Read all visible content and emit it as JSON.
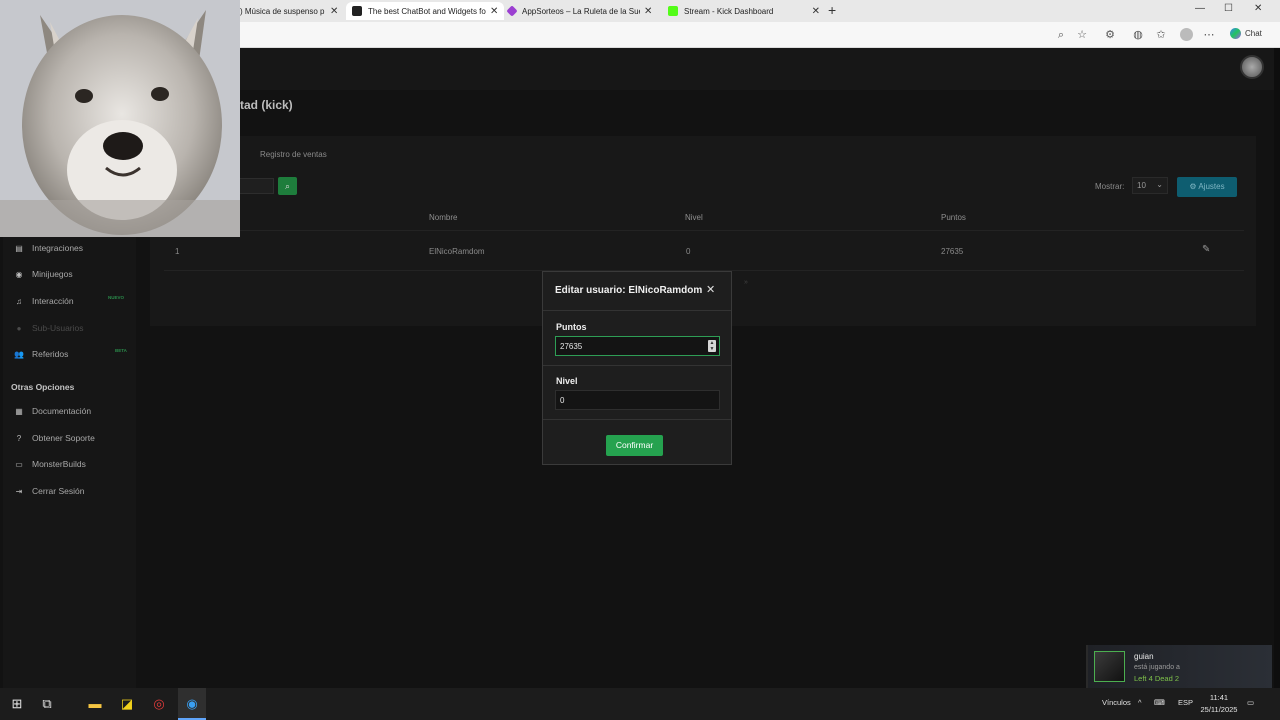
{
  "browser": {
    "tabs": [
      {
        "title": ") Música de suspenso p",
        "icon": "youtube-icon"
      },
      {
        "title": "The best ChatBot and Widgets fo",
        "icon": "chatbot-icon",
        "active": true
      },
      {
        "title": "AppSorteos – La Ruleta de la Sue",
        "icon": "appsorteos-icon"
      },
      {
        "title": "Stream - Kick Dashboard",
        "icon": "kick-icon"
      }
    ],
    "chat_label": "Chat"
  },
  "page": {
    "title": "tad (kick)",
    "subtab": "Registro de ventas",
    "mostrar_label": "Mostrar:",
    "mostrar_value": "10",
    "ajustes_label": "Ajustes",
    "columns": [
      "Nombre",
      "Nivel",
      "Puntos"
    ],
    "rows": [
      {
        "index": "1",
        "nombre": "ElNicoRamdom",
        "nivel": "0",
        "puntos": "27635"
      }
    ]
  },
  "sidebar": {
    "items": [
      {
        "label": "Integraciones",
        "icon": "integrations-icon"
      },
      {
        "label": "Minijuegos",
        "icon": "gamepad-icon"
      },
      {
        "label": "Interacción",
        "icon": "music-icon",
        "badge": "NUEVO"
      },
      {
        "label": "Sub-Usuarios",
        "icon": "users-icon",
        "disabled": true
      },
      {
        "label": "Referidos",
        "icon": "referrals-icon",
        "badge": "BETA"
      }
    ],
    "section_title": "Otras Opciones",
    "other_items": [
      {
        "label": "Documentación",
        "icon": "book-icon"
      },
      {
        "label": "Obtener Soporte",
        "icon": "help-icon"
      },
      {
        "label": "MonsterBuilds",
        "icon": "monitor-icon"
      },
      {
        "label": "Cerrar Sesión",
        "icon": "logout-icon"
      }
    ]
  },
  "modal": {
    "title": "Editar usuario: ElNicoRamdom",
    "puntos_label": "Puntos",
    "puntos_value": "27635",
    "nivel_label": "Nivel",
    "nivel_value": "0",
    "confirm_label": "Confirmar"
  },
  "notification": {
    "name": "guian",
    "status": "está jugando a",
    "game": "Left 4 Dead 2"
  },
  "taskbar": {
    "links_label": "Vínculos",
    "lang": "ESP",
    "time": "11:41",
    "date": "25/11/2025"
  },
  "colors": {
    "accent_green": "#25a24f",
    "focus_border": "#2e9e55",
    "ajustes_blue": "#0e5d70",
    "steam_game_green": "#7ec24a"
  }
}
